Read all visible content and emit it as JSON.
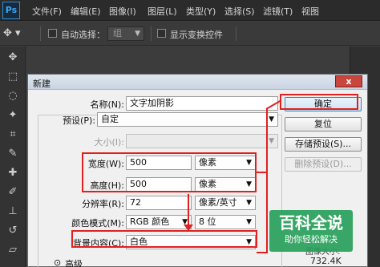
{
  "app": {
    "logo": "Ps"
  },
  "menu": [
    "文件(F)",
    "编辑(E)",
    "图像(I)",
    "图层(L)",
    "类型(Y)",
    "选择(S)",
    "滤镜(T)",
    "视图"
  ],
  "options_bar": {
    "auto_select_label": "自动选择：",
    "auto_select_value": "组",
    "show_transform_label": "显示变换控件"
  },
  "dialog": {
    "title": "新建",
    "close_label": "x",
    "name_label": "名称(N):",
    "name_value": "文字加阴影",
    "preset_label": "预设(P):",
    "preset_value": "自定",
    "size_label": "大小(I):",
    "width_label": "宽度(W):",
    "width_value": "500",
    "width_unit": "像素",
    "height_label": "高度(H):",
    "height_value": "500",
    "height_unit": "像素",
    "resolution_label": "分辨率(R):",
    "resolution_value": "72",
    "resolution_unit": "像素/英寸",
    "color_mode_label": "颜色模式(M):",
    "color_mode_value": "RGB 颜色",
    "bit_depth_value": "8 位",
    "background_label": "背景内容(C):",
    "background_value": "白色",
    "advanced_label": "高级",
    "image_size_label": "图像大小:",
    "image_size_value": "732.4K",
    "buttons": {
      "ok": "确定",
      "reset": "复位",
      "save_preset": "存储预设(S)...",
      "delete_preset": "删除预设(D)..."
    }
  },
  "watermark": {
    "title": "百科全说",
    "subtitle": "助你轻松解决"
  },
  "colors": {
    "annotation": "#e02020",
    "watermark": "#28a05a"
  }
}
